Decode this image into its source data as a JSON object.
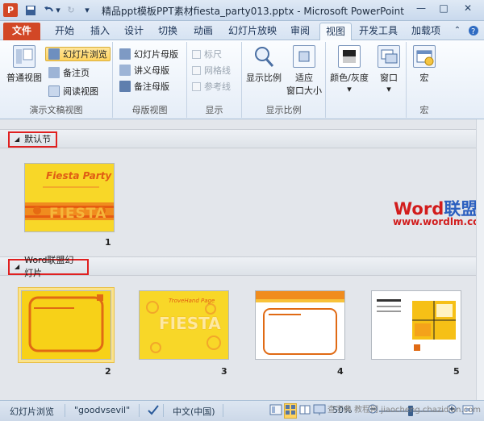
{
  "titlebar": {
    "app_icon": "P",
    "title": "精品ppt模板PPT素材fiesta_party013.pptx - Microsoft PowerPoint",
    "win_min": "—",
    "win_max": "□",
    "win_close": "✕"
  },
  "tabs": [
    {
      "label": "文件"
    },
    {
      "label": "开始"
    },
    {
      "label": "插入"
    },
    {
      "label": "设计"
    },
    {
      "label": "切换"
    },
    {
      "label": "动画"
    },
    {
      "label": "幻灯片放映"
    },
    {
      "label": "审阅"
    },
    {
      "label": "视图"
    },
    {
      "label": "开发工具"
    },
    {
      "label": "加载项"
    }
  ],
  "ribbon": {
    "g1": {
      "label": "演示文稿视图",
      "normal": "普通视图",
      "sorter": "幻灯片浏览",
      "notes": "备注页",
      "reading": "阅读视图"
    },
    "g2": {
      "label": "母版视图",
      "slide_master": "幻灯片母版",
      "handout_master": "讲义母版",
      "notes_master": "备注母版"
    },
    "g3": {
      "label": "显示",
      "ruler": "标尺",
      "grid": "网格线",
      "guides": "参考线"
    },
    "g4": {
      "label": "显示比例",
      "zoom": "显示比例",
      "fit1": "适应",
      "fit2": "窗口大小"
    },
    "g5": {
      "color": "颜色/灰度",
      "window": "窗口"
    },
    "g6": {
      "label": "宏",
      "macro": "宏"
    }
  },
  "sections": [
    {
      "title": "默认节"
    },
    {
      "title": "Word联盟幻灯片"
    }
  ],
  "slides": [
    {
      "number": "1",
      "caption": "Fiesta Party",
      "big": "FIESTA"
    },
    {
      "number": "2",
      "caption": "",
      "big": ""
    },
    {
      "number": "3",
      "caption": "TroveHand Page",
      "big": "FIESTA"
    },
    {
      "number": "4",
      "caption": "",
      "big": ""
    },
    {
      "number": "5",
      "caption": "",
      "big": ""
    }
  ],
  "watermark": {
    "word": "Word",
    "league": "联盟",
    "url": "www.wordlm.com"
  },
  "statusbar": {
    "view": "幻灯片浏览",
    "theme": "\"goodvsevil\"",
    "lang": "中文(中国)",
    "zoom": "50%",
    "footer": "查字典 教程网  jiaocheng.chazidian.com"
  },
  "colors": {
    "file_tab": "#d24726",
    "selection": "#ffd35f",
    "highlight_box": "#e02020"
  }
}
